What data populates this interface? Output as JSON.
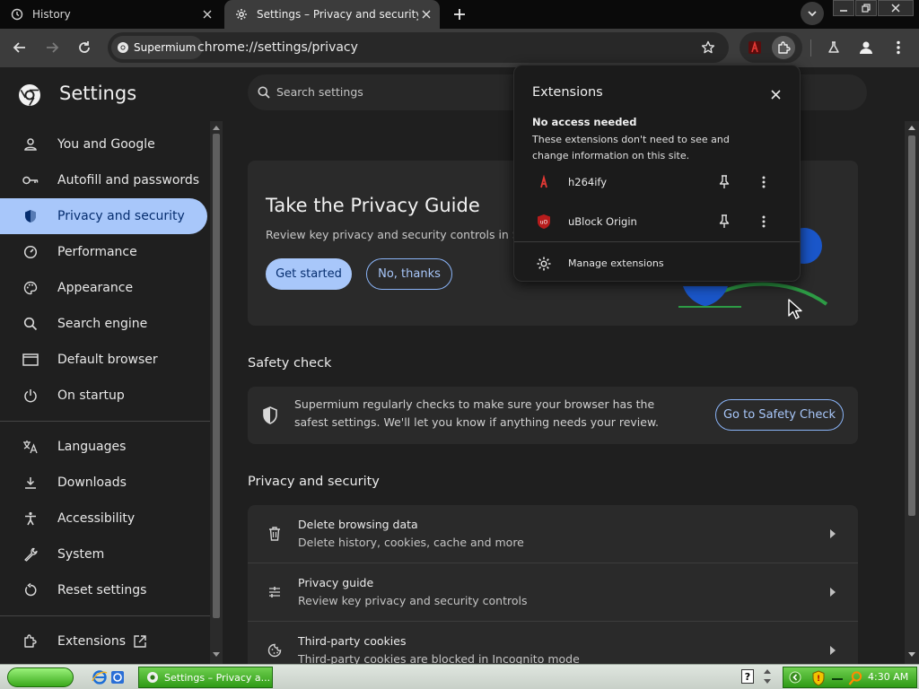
{
  "tabs": [
    {
      "title": "History",
      "icon": "history-icon"
    },
    {
      "title": "Settings – Privacy and security",
      "icon": "gear-icon",
      "active": true
    }
  ],
  "omnibox": {
    "chip": "Supermium",
    "url": "chrome://settings/privacy"
  },
  "settings": {
    "title": "Settings",
    "search_placeholder": "Search settings"
  },
  "sidebar": {
    "items": [
      {
        "label": "You and Google",
        "icon": "person-icon"
      },
      {
        "label": "Autofill and passwords",
        "icon": "key-icon"
      },
      {
        "label": "Privacy and security",
        "icon": "shield-icon",
        "active": true
      },
      {
        "label": "Performance",
        "icon": "gauge-icon"
      },
      {
        "label": "Appearance",
        "icon": "palette-icon"
      },
      {
        "label": "Search engine",
        "icon": "search-icon"
      },
      {
        "label": "Default browser",
        "icon": "browser-window-icon"
      },
      {
        "label": "On startup",
        "icon": "power-icon"
      },
      {
        "label": "Languages",
        "icon": "translate-icon"
      },
      {
        "label": "Downloads",
        "icon": "download-icon"
      },
      {
        "label": "Accessibility",
        "icon": "accessibility-icon"
      },
      {
        "label": "System",
        "icon": "wrench-icon"
      },
      {
        "label": "Reset settings",
        "icon": "reset-icon"
      },
      {
        "label": "Extensions",
        "icon": "puzzle-icon"
      }
    ]
  },
  "privacy_guide": {
    "title": "Take the Privacy Guide",
    "description": "Review key privacy and security controls in Supe",
    "primary_button": "Get started",
    "secondary_button": "No, thanks"
  },
  "safety_check": {
    "section_title": "Safety check",
    "text": "Supermium regularly checks to make sure your browser has the safest settings. We'll let you know if anything needs your review.",
    "button": "Go to Safety Check"
  },
  "privacy_section": {
    "title": "Privacy and security",
    "rows": [
      {
        "title": "Delete browsing data",
        "subtitle": "Delete history, cookies, cache and more",
        "icon": "trash-icon"
      },
      {
        "title": "Privacy guide",
        "subtitle": "Review key privacy and security controls",
        "icon": "tune-icon"
      },
      {
        "title": "Third-party cookies",
        "subtitle": "Third-party cookies are blocked in Incognito mode",
        "icon": "cookie-icon"
      }
    ]
  },
  "extensions_popup": {
    "title": "Extensions",
    "heading": "No access needed",
    "description": "These extensions don't need to see and change information on this site.",
    "extensions": [
      {
        "name": "h264ify",
        "icon": "h264ify-icon"
      },
      {
        "name": "uBlock Origin",
        "icon": "ublock-origin-icon"
      }
    ],
    "manage_label": "Manage extensions"
  },
  "taskbar": {
    "task": "Settings – Privacy a...",
    "clock": "4:30 AM"
  },
  "colors": {
    "accent": "#a8c7fa",
    "background": "#1f1f1f",
    "card": "#2a2a2a",
    "taskbar_green": "#3aa81c"
  }
}
